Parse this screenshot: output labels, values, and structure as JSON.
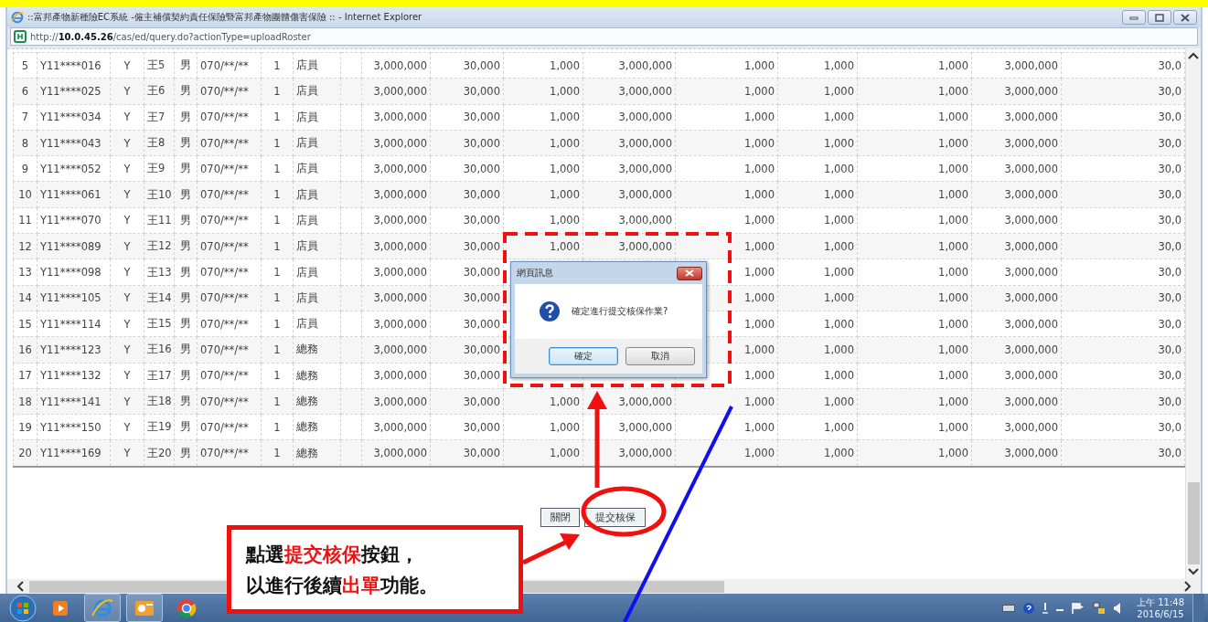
{
  "window": {
    "title": "::富邦產物新種險EC系統 -僱主補償契約責任保險暨富邦產物團體傷害保險 :: - Internet Explorer",
    "address": "http://**10.0.45.26**/cas/ed/query.do?actionType=uploadRoster"
  },
  "table": {
    "rows": [
      {
        "cells": [
          "5",
          "Y11****016",
          "Y",
          "王5",
          "男",
          "070/**/**",
          "1",
          "店員",
          "",
          "3,000,000",
          "30,000",
          "1,000",
          "3,000,000",
          "1,000",
          "1,000",
          "1,000",
          "3,000,000",
          "30,0"
        ]
      },
      {
        "cells": [
          "6",
          "Y11****025",
          "Y",
          "王6",
          "男",
          "070/**/**",
          "1",
          "店員",
          "",
          "3,000,000",
          "30,000",
          "1,000",
          "3,000,000",
          "1,000",
          "1,000",
          "1,000",
          "3,000,000",
          "30,0"
        ]
      },
      {
        "cells": [
          "7",
          "Y11****034",
          "Y",
          "王7",
          "男",
          "070/**/**",
          "1",
          "店員",
          "",
          "3,000,000",
          "30,000",
          "1,000",
          "3,000,000",
          "1,000",
          "1,000",
          "1,000",
          "3,000,000",
          "30,0"
        ]
      },
      {
        "cells": [
          "8",
          "Y11****043",
          "Y",
          "王8",
          "男",
          "070/**/**",
          "1",
          "店員",
          "",
          "3,000,000",
          "30,000",
          "1,000",
          "3,000,000",
          "1,000",
          "1,000",
          "1,000",
          "3,000,000",
          "30,0"
        ]
      },
      {
        "cells": [
          "9",
          "Y11****052",
          "Y",
          "王9",
          "男",
          "070/**/**",
          "1",
          "店員",
          "",
          "3,000,000",
          "30,000",
          "1,000",
          "3,000,000",
          "1,000",
          "1,000",
          "1,000",
          "3,000,000",
          "30,0"
        ]
      },
      {
        "cells": [
          "10",
          "Y11****061",
          "Y",
          "王10",
          "男",
          "070/**/**",
          "1",
          "店員",
          "",
          "3,000,000",
          "30,000",
          "1,000",
          "3,000,000",
          "1,000",
          "1,000",
          "1,000",
          "3,000,000",
          "30,0"
        ]
      },
      {
        "cells": [
          "11",
          "Y11****070",
          "Y",
          "王11",
          "男",
          "070/**/**",
          "1",
          "店員",
          "",
          "3,000,000",
          "30,000",
          "1,000",
          "3,000,000",
          "1,000",
          "1,000",
          "1,000",
          "3,000,000",
          "30,0"
        ]
      },
      {
        "cells": [
          "12",
          "Y11****089",
          "Y",
          "王12",
          "男",
          "070/**/**",
          "1",
          "店員",
          "",
          "3,000,000",
          "30,000",
          "1,000",
          "3,000,000",
          "1,000",
          "1,000",
          "1,000",
          "3,000,000",
          "30,0"
        ]
      },
      {
        "cells": [
          "13",
          "Y11****098",
          "Y",
          "王13",
          "男",
          "070/**/**",
          "1",
          "店員",
          "",
          "3,000,000",
          "30,000",
          null,
          null,
          "1,000",
          "1,000",
          "1,000",
          "3,000,000",
          "30,0"
        ]
      },
      {
        "cells": [
          "14",
          "Y11****105",
          "Y",
          "王14",
          "男",
          "070/**/**",
          "1",
          "店員",
          "",
          "3,000,000",
          "30,000",
          null,
          null,
          "1,000",
          "1,000",
          "1,000",
          "3,000,000",
          "30,0"
        ]
      },
      {
        "cells": [
          "15",
          "Y11****114",
          "Y",
          "王15",
          "男",
          "070/**/**",
          "1",
          "店員",
          "",
          "3,000,000",
          "30,000",
          null,
          null,
          "1,000",
          "1,000",
          "1,000",
          "3,000,000",
          "30,0"
        ]
      },
      {
        "cells": [
          "16",
          "Y11****123",
          "Y",
          "王16",
          "男",
          "070/**/**",
          "1",
          "總務",
          "",
          "3,000,000",
          "30,000",
          null,
          null,
          "1,000",
          "1,000",
          "1,000",
          "3,000,000",
          "30,0"
        ]
      },
      {
        "cells": [
          "17",
          "Y11****132",
          "Y",
          "王17",
          "男",
          "070/**/**",
          "1",
          "總務",
          "",
          "3,000,000",
          "30,000",
          null,
          null,
          "1,000",
          "1,000",
          "1,000",
          "3,000,000",
          "30,0"
        ]
      },
      {
        "cells": [
          "18",
          "Y11****141",
          "Y",
          "王18",
          "男",
          "070/**/**",
          "1",
          "總務",
          "",
          "3,000,000",
          "30,000",
          "1,000",
          "3,000,000",
          "1,000",
          "1,000",
          "1,000",
          "3,000,000",
          "30,0"
        ]
      },
      {
        "cells": [
          "19",
          "Y11****150",
          "Y",
          "王19",
          "男",
          "070/**/**",
          "1",
          "總務",
          "",
          "3,000,000",
          "30,000",
          "1,000",
          "3,000,000",
          "1,000",
          "1,000",
          "1,000",
          "3,000,000",
          "30,0"
        ]
      },
      {
        "cells": [
          "20",
          "Y11****169",
          "Y",
          "王20",
          "男",
          "070/**/**",
          "1",
          "總務",
          "",
          "3,000,000",
          "30,000",
          "1,000",
          "3,000,000",
          "1,000",
          "1,000",
          "1,000",
          "3,000,000",
          "30,0"
        ]
      }
    ]
  },
  "buttons": [
    "關閉",
    "提交核保"
  ],
  "dialog": {
    "title": "網頁訊息",
    "message": "確定進行提交核保作業?",
    "buttons": [
      {
        "label": "確定",
        "focused": true
      },
      {
        "label": "取消",
        "focused": false
      }
    ]
  },
  "callout": {
    "lines": [
      "點選**提交核保**按鈕，",
      "以進行後續**出單**功能。"
    ]
  },
  "taskbar": {
    "apps": [
      {
        "kind": "media",
        "running": false
      },
      {
        "kind": "ie",
        "running": true
      },
      {
        "kind": "mail",
        "running": true
      },
      {
        "kind": "chrome",
        "running": false
      }
    ],
    "clock": {
      "time": "上午 11:48",
      "date": "2016/6/15"
    }
  }
}
